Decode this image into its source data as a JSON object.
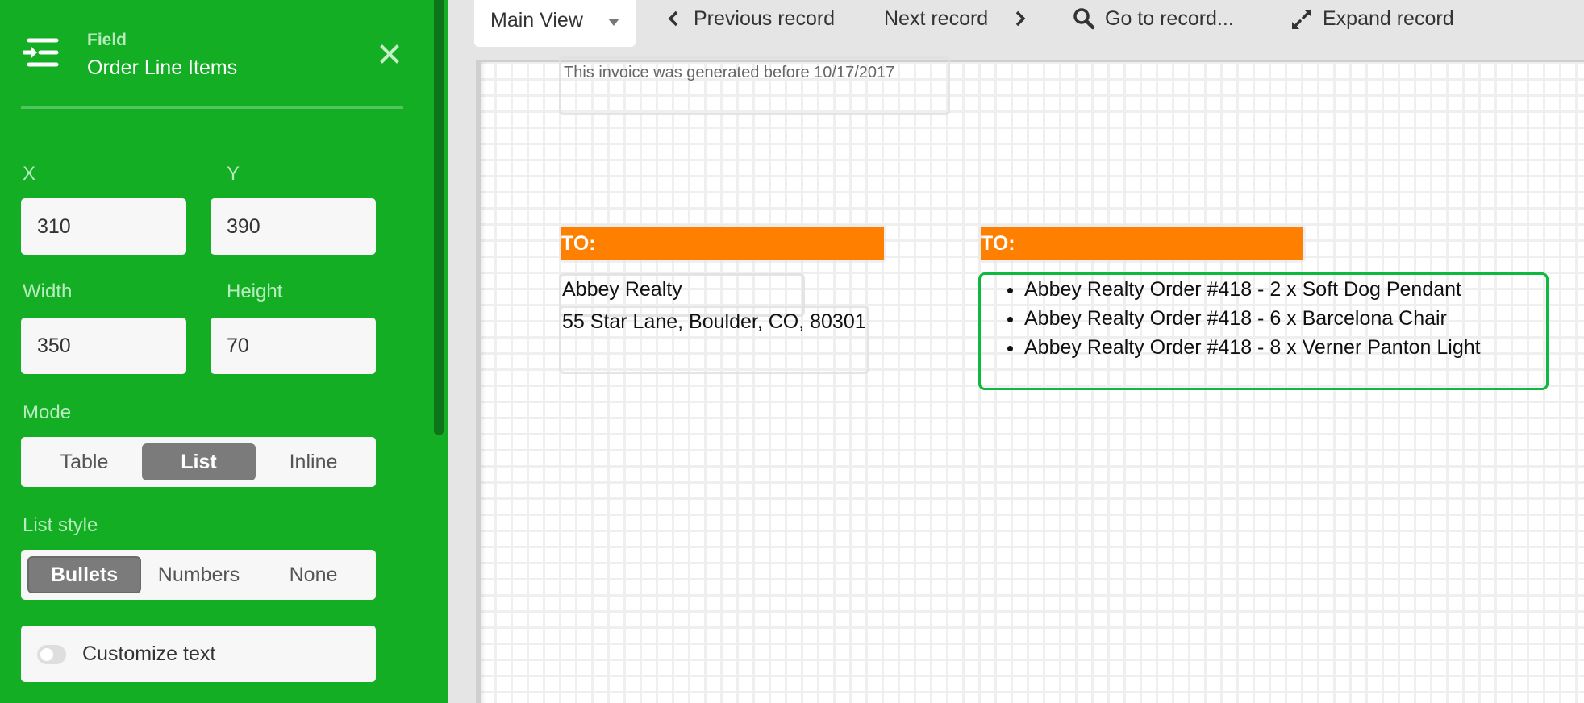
{
  "sidebar": {
    "kicker": "Field",
    "title": "Order Line Items",
    "header_icon": "indent-list-icon",
    "close_icon": "close-icon",
    "fields": {
      "x": {
        "label": "X",
        "value": "310"
      },
      "y": {
        "label": "Y",
        "value": "390"
      },
      "width": {
        "label": "Width",
        "value": "350"
      },
      "height": {
        "label": "Height",
        "value": "70"
      }
    },
    "mode": {
      "label": "Mode",
      "options": [
        "Table",
        "List",
        "Inline"
      ],
      "selected": "List"
    },
    "list_style": {
      "label": "List style",
      "options": [
        "Bullets",
        "Numbers",
        "None"
      ],
      "selected": "Bullets"
    },
    "customize_text": {
      "label": "Customize text",
      "enabled": false
    }
  },
  "toolbar": {
    "view_tab": "Main View",
    "previous": "Previous record",
    "next": "Next record",
    "goto": "Go to record...",
    "expand": "Expand record"
  },
  "canvas": {
    "notice": "This invoice was generated before 10/17/2017",
    "to_left": "TO:",
    "to_right": "TO:",
    "customer_name": "Abbey Realty",
    "customer_address": "55 Star Lane, Boulder, CO, 80301",
    "line_items": [
      "Abbey Realty Order #418 - 2 x Soft Dog Pendant",
      "Abbey Realty Order #418 - 6 x Barcelona Chair",
      "Abbey Realty Order #418 - 8 x Verner Panton Light"
    ]
  },
  "colors": {
    "sidebar_green": "#13ae23",
    "accent_orange": "#ff7f00",
    "selection_green": "#0fb840"
  }
}
